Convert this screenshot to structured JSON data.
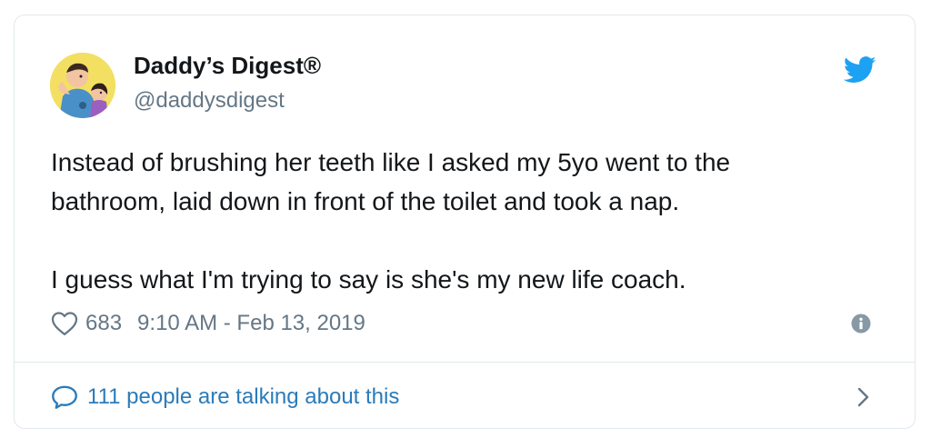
{
  "author": {
    "name": "Daddy’s Digest®",
    "handle": "@daddysdigest",
    "avatar_icon": "cartoon-family-avatar"
  },
  "tweet": {
    "paragraphs": [
      "Instead of brushing her teeth like I asked my 5yo went to the",
      "bathroom, laid down in front of the toilet and took a nap.",
      "I guess what I'm trying to say is she's my new life coach."
    ],
    "likes": "683",
    "timestamp": "9:10 AM - Feb 13, 2019"
  },
  "footer": {
    "conversation_label": "111 people are talking about this"
  },
  "icons": {
    "brand": "twitter-bird-icon",
    "like": "heart-icon",
    "info": "info-icon",
    "reply": "speech-bubble-icon",
    "chevron": "chevron-right-icon"
  },
  "colors": {
    "brand_blue": "#1da1f2",
    "link_blue": "#2b7bb9",
    "text_primary": "#14171a",
    "text_secondary": "#657786",
    "border": "#e1e8ed"
  }
}
